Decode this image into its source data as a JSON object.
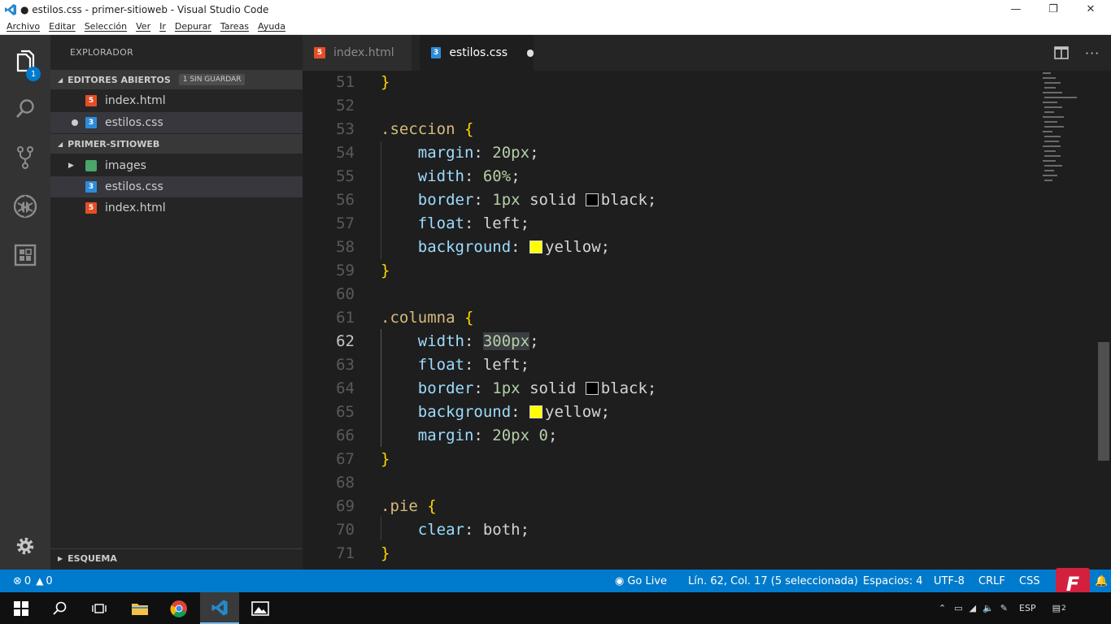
{
  "window": {
    "title": "● estilos.css - primer-sitioweb - Visual Studio Code",
    "minimize": "—",
    "maximize": "❐",
    "close": "✕"
  },
  "menu": [
    "Archivo",
    "Editar",
    "Selección",
    "Ver",
    "Ir",
    "Depurar",
    "Tareas",
    "Ayuda"
  ],
  "activity": {
    "explorer_badge": "1",
    "icons": [
      "files-icon",
      "search-icon",
      "source-control-icon",
      "debug-icon",
      "extensions-icon",
      "gear-icon"
    ]
  },
  "sidebar": {
    "title": "EXPLORADOR",
    "open_editors": {
      "label": "EDITORES ABIERTOS",
      "badge": "1 SIN GUARDAR",
      "items": [
        {
          "name": "index.html",
          "type": "html"
        },
        {
          "name": "estilos.css",
          "type": "css",
          "dirty": true
        }
      ]
    },
    "project": {
      "label": "PRIMER-SITIOWEB",
      "items": [
        {
          "name": "images",
          "type": "folder"
        },
        {
          "name": "estilos.css",
          "type": "css"
        },
        {
          "name": "index.html",
          "type": "html"
        }
      ]
    },
    "outline": {
      "label": "ESQUEMA"
    }
  },
  "tabs": [
    {
      "label": "index.html",
      "type": "html",
      "active": false
    },
    {
      "label": "estilos.css",
      "type": "css",
      "active": true,
      "dirty": true
    }
  ],
  "editor": {
    "current_line": 62,
    "lines": [
      {
        "n": "51",
        "text": "}"
      },
      {
        "n": "52",
        "text": ""
      },
      {
        "n": "53",
        "text": ".seccion {"
      },
      {
        "n": "54",
        "text": "    margin: 20px;"
      },
      {
        "n": "55",
        "text": "    width: 60%;"
      },
      {
        "n": "56",
        "text": "    border: 1px solid black;"
      },
      {
        "n": "57",
        "text": "    float: left;"
      },
      {
        "n": "58",
        "text": "    background: yellow;"
      },
      {
        "n": "59",
        "text": "}"
      },
      {
        "n": "60",
        "text": ""
      },
      {
        "n": "61",
        "text": ".columna {"
      },
      {
        "n": "62",
        "text": "    width: 300px;"
      },
      {
        "n": "63",
        "text": "    float: left;"
      },
      {
        "n": "64",
        "text": "    border: 1px solid black;"
      },
      {
        "n": "65",
        "text": "    background: yellow;"
      },
      {
        "n": "66",
        "text": "    margin: 20px 0;"
      },
      {
        "n": "67",
        "text": "}"
      },
      {
        "n": "68",
        "text": ""
      },
      {
        "n": "69",
        "text": ".pie {"
      },
      {
        "n": "70",
        "text": "    clear: both;"
      },
      {
        "n": "71",
        "text": "}"
      }
    ]
  },
  "status": {
    "errors": "0",
    "warnings": "0",
    "go_live": "Go Live",
    "position": "Lín. 62, Col. 17 (5 seleccionada)",
    "spaces": "Espacios: 4",
    "encoding": "UTF-8",
    "eol": "CRLF",
    "language": "CSS",
    "watermark": "F"
  },
  "taskbar": {
    "tray_lang": "ESP",
    "notif_count": "2"
  },
  "colors": {
    "statusbar": "#007acc",
    "selector": "#d7ba7d",
    "property": "#9cdcfe",
    "number": "#b5cea8",
    "brace": "#ffd700"
  }
}
